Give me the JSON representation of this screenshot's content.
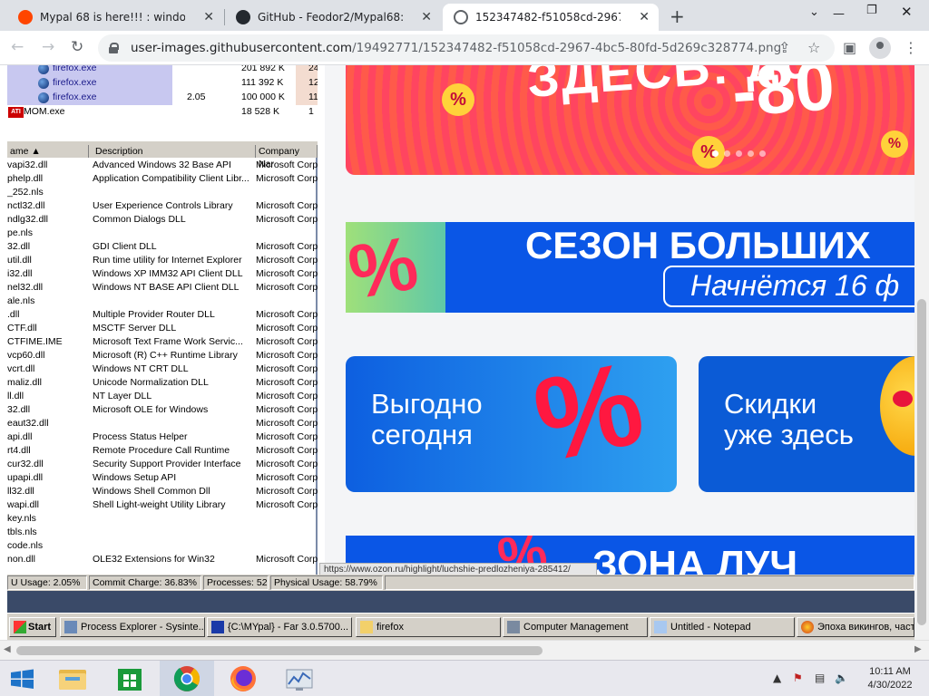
{
  "browser": {
    "tabs": [
      {
        "title": "Mypal 68 is here!!! : windowsxp",
        "favicon": "reddit-icon"
      },
      {
        "title": "GitHub - Feodor2/Mypal68: web",
        "favicon": "github-icon"
      },
      {
        "title": "152347482-f51058cd-2967-4bc5",
        "favicon": "globe-icon",
        "active": true
      }
    ],
    "url_host": "user-images.githubusercontent.com",
    "url_path": "/19492771/152347482-f51058cd-2967-4bc5-80fd-5d269c328774.png"
  },
  "xp": {
    "processes": [
      {
        "name": "firefox.exe",
        "cpu": "",
        "mem": "201 892 K",
        "peak": "24"
      },
      {
        "name": "firefox.exe",
        "cpu": "",
        "mem": "111 392 K",
        "peak": "12"
      },
      {
        "name": "firefox.exe",
        "cpu": "2.05",
        "mem": "100 000 K",
        "peak": "11"
      },
      {
        "name": "MOM.exe",
        "cpu": "",
        "mem": "18 528 K",
        "peak": "1"
      }
    ],
    "dll_headers": {
      "name": "ame",
      "description": "Description",
      "company": "Company Nar"
    },
    "dlls": [
      {
        "n": "vapi32.dll",
        "d": "Advanced Windows 32 Base API",
        "c": "Microsoft Corp"
      },
      {
        "n": "phelp.dll",
        "d": "Application Compatibility Client Libr...",
        "c": "Microsoft Corp"
      },
      {
        "n": "_252.nls",
        "d": "",
        "c": ""
      },
      {
        "n": "nctl32.dll",
        "d": "User Experience Controls Library",
        "c": "Microsoft Corp"
      },
      {
        "n": "ndlg32.dll",
        "d": "Common Dialogs DLL",
        "c": "Microsoft Corp"
      },
      {
        "n": "pe.nls",
        "d": "",
        "c": ""
      },
      {
        "n": "32.dll",
        "d": "GDI Client DLL",
        "c": "Microsoft Corp"
      },
      {
        "n": "util.dll",
        "d": "Run time utility for Internet Explorer",
        "c": "Microsoft Corp"
      },
      {
        "n": "i32.dll",
        "d": "Windows XP IMM32 API Client DLL",
        "c": "Microsoft Corp"
      },
      {
        "n": "nel32.dll",
        "d": "Windows NT BASE API Client DLL",
        "c": "Microsoft Corp"
      },
      {
        "n": "ale.nls",
        "d": "",
        "c": ""
      },
      {
        "n": ".dll",
        "d": "Multiple Provider Router DLL",
        "c": "Microsoft Corp"
      },
      {
        "n": "CTF.dll",
        "d": "MSCTF Server DLL",
        "c": "Microsoft Corp"
      },
      {
        "n": "CTFIME.IME",
        "d": "Microsoft Text Frame Work Servic...",
        "c": "Microsoft Corp"
      },
      {
        "n": "vcp60.dll",
        "d": "Microsoft (R) C++ Runtime Library",
        "c": "Microsoft Corp"
      },
      {
        "n": "vcrt.dll",
        "d": "Windows NT CRT DLL",
        "c": "Microsoft Corp"
      },
      {
        "n": "maliz.dll",
        "d": "Unicode Normalization DLL",
        "c": "Microsoft Corp"
      },
      {
        "n": "ll.dll",
        "d": "NT Layer DLL",
        "c": "Microsoft Corp"
      },
      {
        "n": "32.dll",
        "d": "Microsoft OLE for Windows",
        "c": "Microsoft Corp"
      },
      {
        "n": "eaut32.dll",
        "d": "",
        "c": "Microsoft Corp"
      },
      {
        "n": "api.dll",
        "d": "Process Status Helper",
        "c": "Microsoft Corp"
      },
      {
        "n": "rt4.dll",
        "d": "Remote Procedure Call Runtime",
        "c": "Microsoft Corp"
      },
      {
        "n": "cur32.dll",
        "d": "Security Support Provider Interface",
        "c": "Microsoft Corp"
      },
      {
        "n": "upapi.dll",
        "d": "Windows Setup API",
        "c": "Microsoft Corp"
      },
      {
        "n": "ll32.dll",
        "d": "Windows Shell Common Dll",
        "c": "Microsoft Corp"
      },
      {
        "n": "wapi.dll",
        "d": "Shell Light-weight Utility Library",
        "c": "Microsoft Corp"
      },
      {
        "n": "key.nls",
        "d": "",
        "c": ""
      },
      {
        "n": "tbls.nls",
        "d": "",
        "c": ""
      },
      {
        "n": "code.nls",
        "d": "",
        "c": ""
      },
      {
        "n": "non.dll",
        "d": "OLE32 Extensions for Win32",
        "c": "Microsoft Corp"
      }
    ],
    "status": {
      "cpu": "U Usage: 2.05%",
      "commit": "Commit Charge: 36.83%",
      "processes": "Processes: 52",
      "physical": "Physical Usage: 58.79%"
    },
    "url_tooltip": "https://www.ozon.ru/highlight/luchshie-predlozheniya-285412/",
    "taskbar": [
      {
        "label": "Start"
      },
      {
        "label": "Process Explorer - Sysinte..."
      },
      {
        "label": "{C:\\MYpal} - Far 3.0.5700..."
      },
      {
        "label": "firefox"
      },
      {
        "label": "Computer Management"
      },
      {
        "label": "Untitled - Notepad"
      },
      {
        "label": "Эпоха викингов, часть"
      }
    ]
  },
  "ozon": {
    "banner1_text": "ЗДЕСЬ: до",
    "banner1_discount": "-80",
    "banner2_headline": "СЕЗОН БОЛЬШИХ",
    "banner2_sub": "Начнётся 16 ф",
    "card1_text": "Выгодно\nсегодня",
    "card2_text": "Скидки\nуже здесь",
    "banner3_text": "ЗОНА ЛУЧ",
    "percent": "%"
  },
  "clock": {
    "time": "10:11 AM",
    "date": "4/30/2022"
  }
}
